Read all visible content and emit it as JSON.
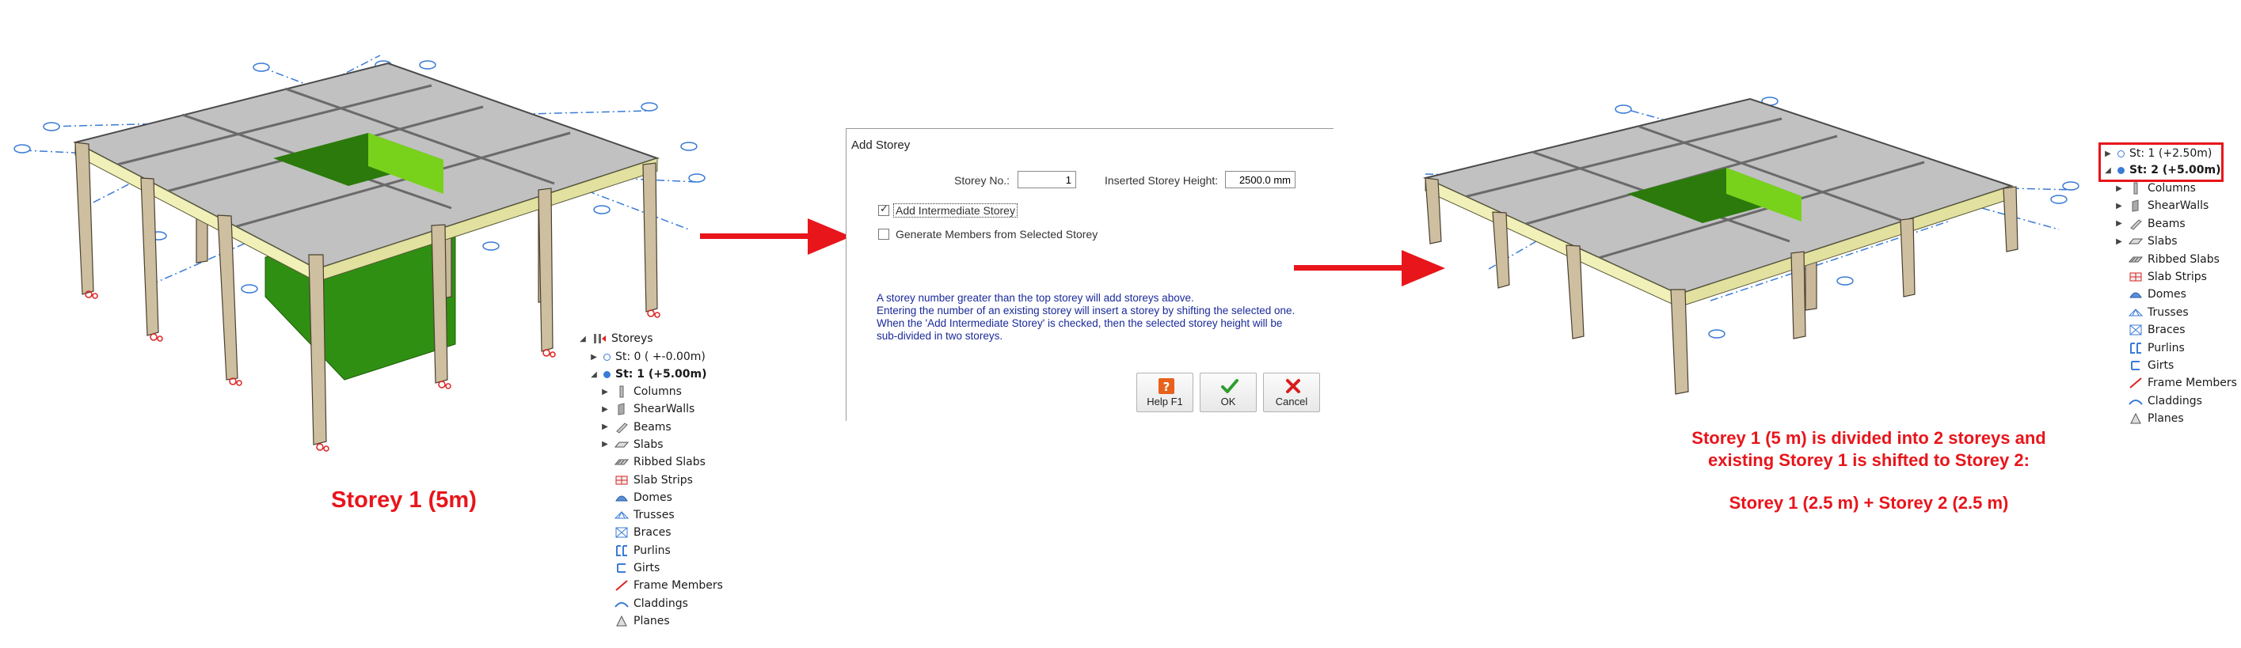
{
  "left_caption": "Storey 1 (5m)",
  "right_caption": {
    "line1": "Storey 1 (5 m) is divided into 2 storeys and",
    "line2": "existing Storey 1 is shifted to Storey 2:",
    "line3": "Storey 1 (2.5 m) + Storey 2 (2.5 m)"
  },
  "left_tree": {
    "root": "Storeys",
    "storeys": [
      {
        "label": "St: 0 ( +-0.00m)",
        "bold": false
      },
      {
        "label": "St: 1 (+5.00m)",
        "bold": true
      }
    ],
    "members": [
      "Columns",
      "ShearWalls",
      "Beams",
      "Slabs",
      "Ribbed Slabs",
      "Slab Strips",
      "Domes",
      "Trusses",
      "Braces",
      "Purlins",
      "Girts",
      "Frame Members",
      "Claddings",
      "Planes"
    ]
  },
  "right_tree": {
    "storeys": [
      {
        "label": "St: 1 (+2.50m)",
        "bold": false
      },
      {
        "label": "St: 2 (+5.00m)",
        "bold": true
      }
    ],
    "members": [
      "Columns",
      "ShearWalls",
      "Beams",
      "Slabs",
      "Ribbed Slabs",
      "Slab Strips",
      "Domes",
      "Trusses",
      "Braces",
      "Purlins",
      "Girts",
      "Frame Members",
      "Claddings",
      "Planes"
    ]
  },
  "dialog": {
    "title": "Add Storey",
    "storey_no_label": "Storey No.:",
    "storey_no_value": "1",
    "height_label": "Inserted Storey Height:",
    "height_value": "2500.0 mm",
    "checkbox1_label": "Add Intermediate Storey",
    "checkbox1_checked": true,
    "checkbox2_label": "Generate Members from Selected Storey",
    "checkbox2_checked": false,
    "info_lines": [
      "A storey number greater than the top storey will add storeys above.",
      "Entering the number of an existing storey will insert a storey by shifting the selected one.",
      "When the 'Add Intermediate Storey' is checked, then the selected storey height will be",
      "sub-divided in two storeys."
    ],
    "buttons": {
      "help": "Help  F1",
      "ok": "OK",
      "cancel": "Cancel"
    }
  },
  "colors": {
    "accent_red": "#e8151b",
    "slab": "#b9b9b9",
    "opening": "#5fb81a",
    "beam": "#f1f0b8",
    "column": "#c9b99a",
    "axis": "#3a7bd5",
    "info_text": "#1a2a9a"
  }
}
